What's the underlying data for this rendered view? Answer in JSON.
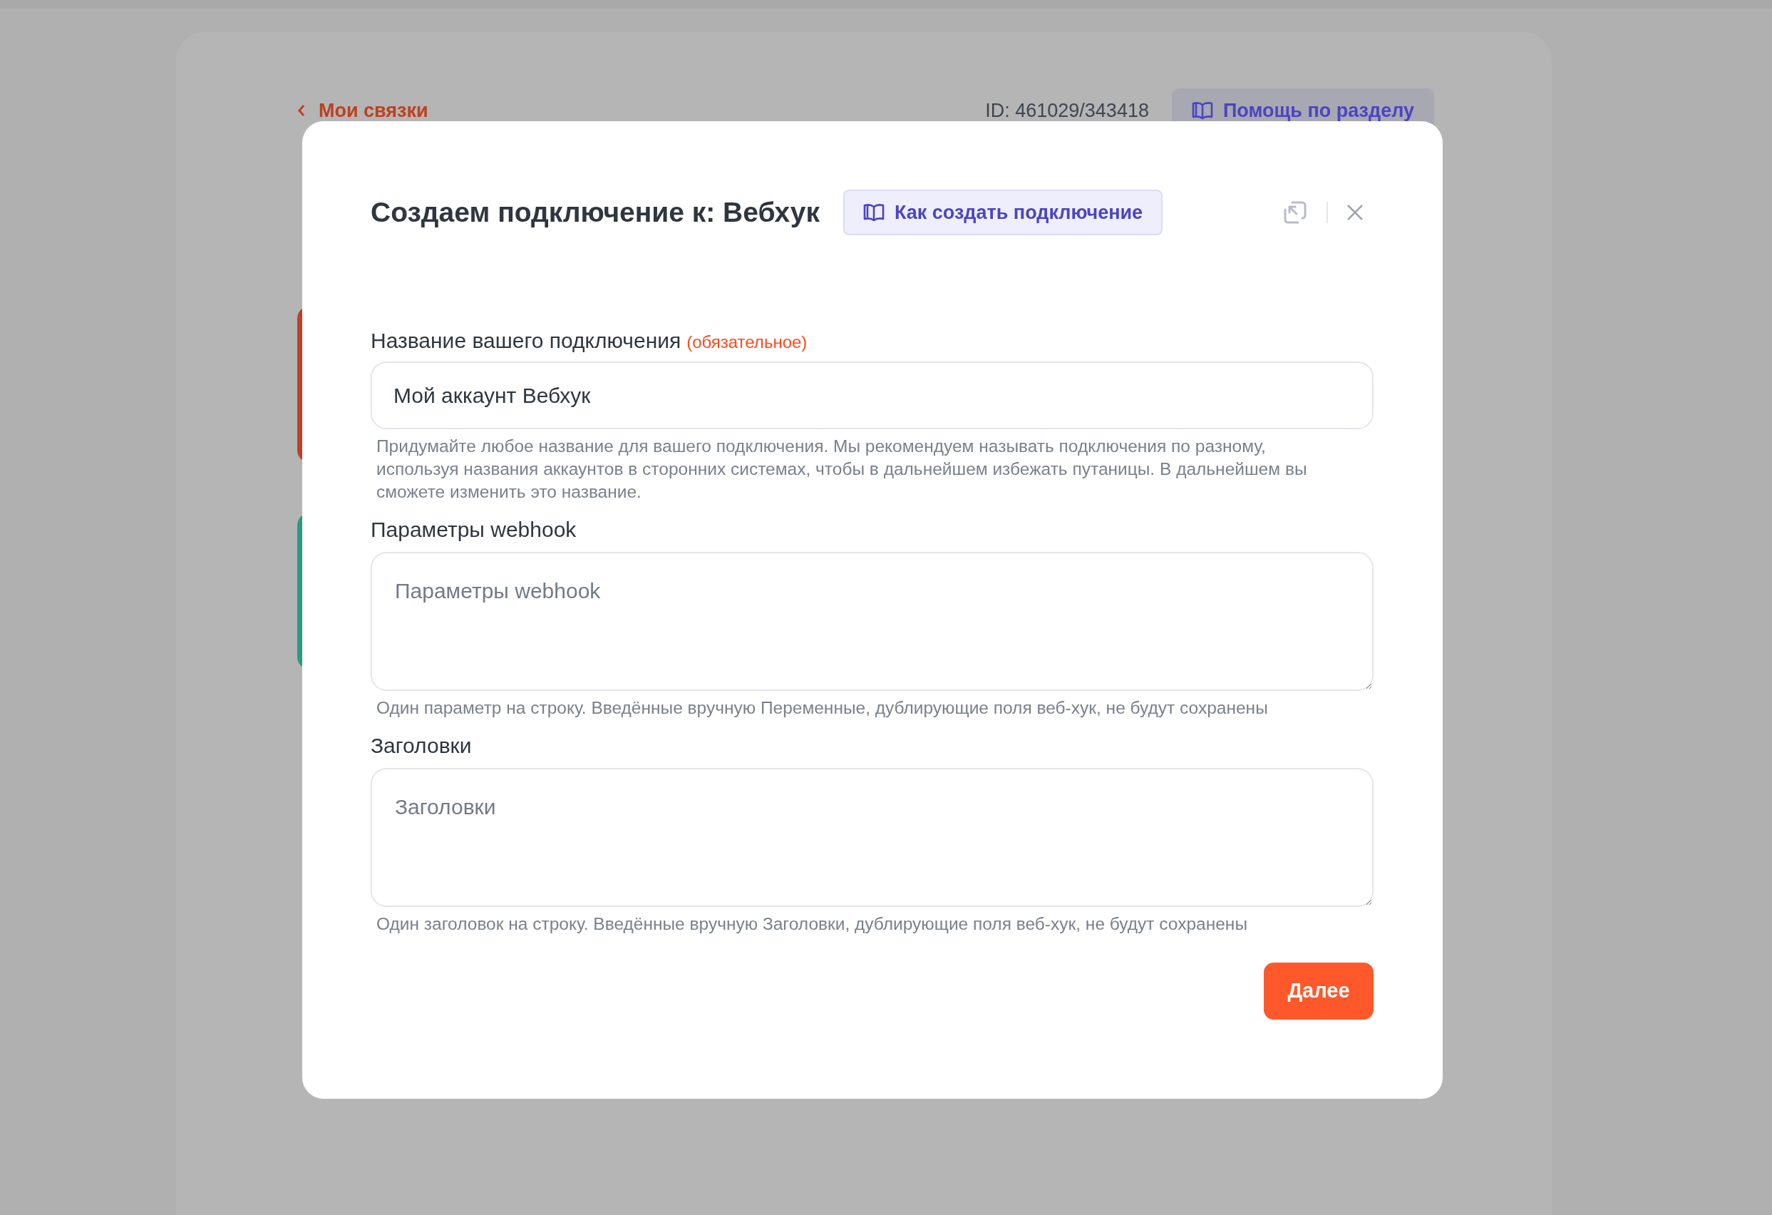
{
  "page": {
    "back_link": "Мои связки",
    "id_text": "ID: 461029/343418",
    "help_button": "Помощь по разделу",
    "background_cards": [
      {
        "color": "#bb4226"
      },
      {
        "color": "#2a9a80"
      }
    ]
  },
  "dialog": {
    "title": "Создаем подключение к: Вебхук",
    "guide_button": "Как создать подключение",
    "fields": [
      {
        "kind": "input",
        "label": "Название вашего подключения",
        "required_note": "(обязательное)",
        "value": "Мой аккаунт Вебхук",
        "hint": "Придумайте любое название для вашего подключения. Мы рекомендуем называть подключения по разному, используя названия аккаунтов в сторонних системах, чтобы в дальнейшем избежать путаницы. В дальнейшем вы сможете изменить это название."
      },
      {
        "kind": "textarea",
        "label": "Параметры webhook",
        "placeholder": "Параметры webhook",
        "hint": "Один параметр на строку. Введённые вручную Переменные, дублирующие поля веб-хук, не будут сохранены"
      },
      {
        "kind": "textarea",
        "label": "Заголовки",
        "placeholder": "Заголовки",
        "hint": "Один заголовок на строку. Введённые вручную Заголовки, дублирующие поля веб-хук, не будут сохранены"
      }
    ],
    "next_button": "Далее"
  }
}
